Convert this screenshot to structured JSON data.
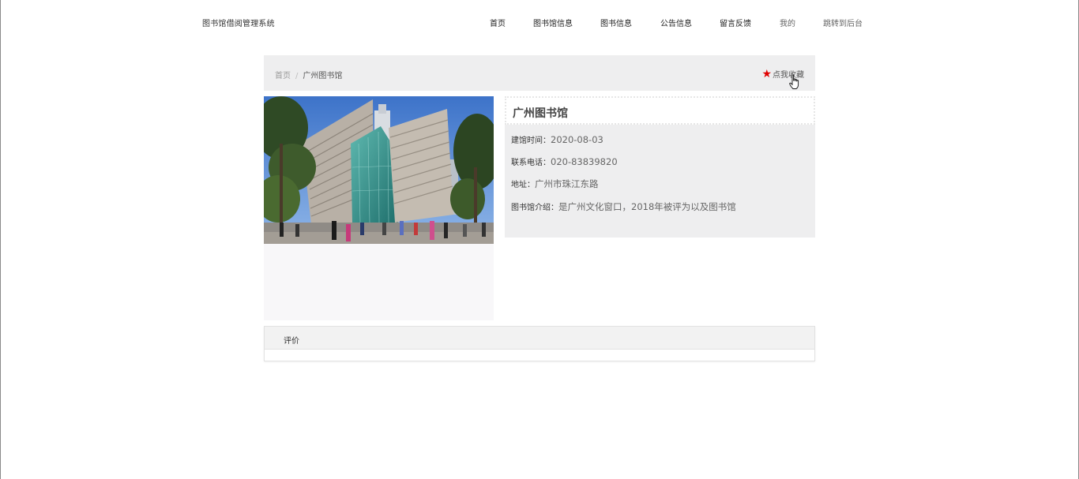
{
  "header": {
    "brand": "图书馆借阅管理系统",
    "nav": [
      {
        "label": "首页"
      },
      {
        "label": "图书馆信息"
      },
      {
        "label": "图书信息"
      },
      {
        "label": "公告信息"
      },
      {
        "label": "留言反馈"
      },
      {
        "label": "我的"
      },
      {
        "label": "跳转到后台"
      }
    ]
  },
  "breadcrumb": {
    "home": "首页",
    "separator": "/",
    "current": "广州图书馆"
  },
  "favorite": {
    "label": "点我收藏",
    "icon": "star-icon",
    "icon_color": "#e00000"
  },
  "library": {
    "name": "广州图书馆",
    "fields": [
      {
        "key": "建馆时间：",
        "value": "2020-08-03"
      },
      {
        "key": "联系电话：",
        "value": "020-83839820"
      },
      {
        "key": "地址：",
        "value": "广州市珠江东路"
      },
      {
        "key": "图书馆介绍：",
        "value": "是广州文化窗口，2018年被评为以及图书馆"
      }
    ]
  },
  "review": {
    "tab_label": "评价"
  }
}
